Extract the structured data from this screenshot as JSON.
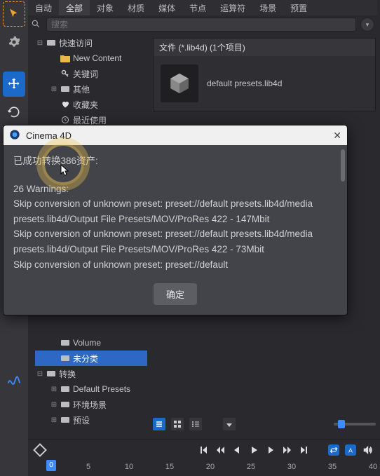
{
  "tabs": {
    "items": [
      "自动",
      "全部",
      "对象",
      "材质",
      "媒体",
      "节点",
      "运算符",
      "场景",
      "预置"
    ],
    "active_index": 1
  },
  "search": {
    "placeholder": "搜索"
  },
  "tree": {
    "root_label": "快速访问",
    "items": [
      {
        "label": "New Content",
        "icon": "folder"
      },
      {
        "label": "关键词",
        "icon": "key"
      },
      {
        "label": "其他",
        "icon": "box",
        "expandable": true
      },
      {
        "label": "收藏夹",
        "icon": "heart"
      },
      {
        "label": "最近使用",
        "icon": "clock"
      }
    ]
  },
  "file_panel": {
    "header": "文件 (*.lib4d) (1个项目)",
    "item_label": "default presets.lib4d"
  },
  "dialog": {
    "title": "Cinema 4D",
    "line1": "已成功转换386资产:",
    "warnings_header": "26 Warnings:",
    "body_lines": [
      "Skip conversion of unknown preset: preset://default presets.lib4d/media presets.lib4d/Output File Presets/MOV/ProRes 422 - 147Mbit",
      "Skip conversion of unknown preset: preset://default presets.lib4d/media presets.lib4d/Output File Presets/MOV/ProRes 422 - 73Mbit",
      "Skip conversion of unknown preset: preset://default"
    ],
    "ok_label": "确定"
  },
  "tree2": {
    "items": [
      {
        "label": "Volume",
        "icon": "box",
        "expandable": false
      },
      {
        "label": "未分类",
        "icon": "box",
        "selected": true
      },
      {
        "label": "转换",
        "icon": "box",
        "expandable": true
      },
      {
        "label": "Default Presets",
        "icon": "box",
        "expandable": true,
        "indent": 2
      },
      {
        "label": "环境场景",
        "icon": "box",
        "expandable": true,
        "indent": 2
      },
      {
        "label": "预设",
        "icon": "box",
        "expandable": true,
        "indent": 2
      }
    ]
  },
  "timeline": {
    "ticks": [
      "0",
      "5",
      "10",
      "15",
      "20",
      "25",
      "30",
      "35",
      "40"
    ]
  }
}
